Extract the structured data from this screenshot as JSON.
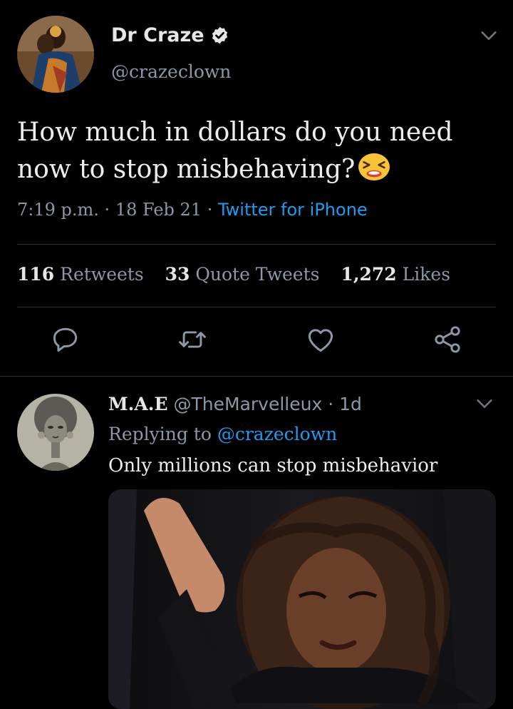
{
  "tweet": {
    "author_name": "Dr Craze",
    "author_handle": "@crazeclown",
    "text": "How much in dollars do you need now to stop misbehaving?",
    "emoji": "persevering-face",
    "time": "7:19 p.m.",
    "date": "18 Feb 21",
    "client": "Twitter for iPhone",
    "stats": {
      "retweets_count": "116",
      "retweets_label": "Retweets",
      "quotes_count": "33",
      "quotes_label": "Quote Tweets",
      "likes_count": "1,272",
      "likes_label": "Likes"
    },
    "action_icons": [
      "reply-icon",
      "retweet-icon",
      "like-icon",
      "share-icon"
    ]
  },
  "reply": {
    "author_name": "M.A.E",
    "author_handle": "@TheMarvelleux",
    "age": "1d",
    "replying_prefix": "Replying to",
    "replying_to": "@crazeclown",
    "text": "Only millions can stop misbehavior",
    "media": "gif-image"
  },
  "colors": {
    "background": "#000000",
    "accent": "#1d9bf0",
    "secondary_text": "#8b98a5",
    "divider": "#2f3336"
  }
}
